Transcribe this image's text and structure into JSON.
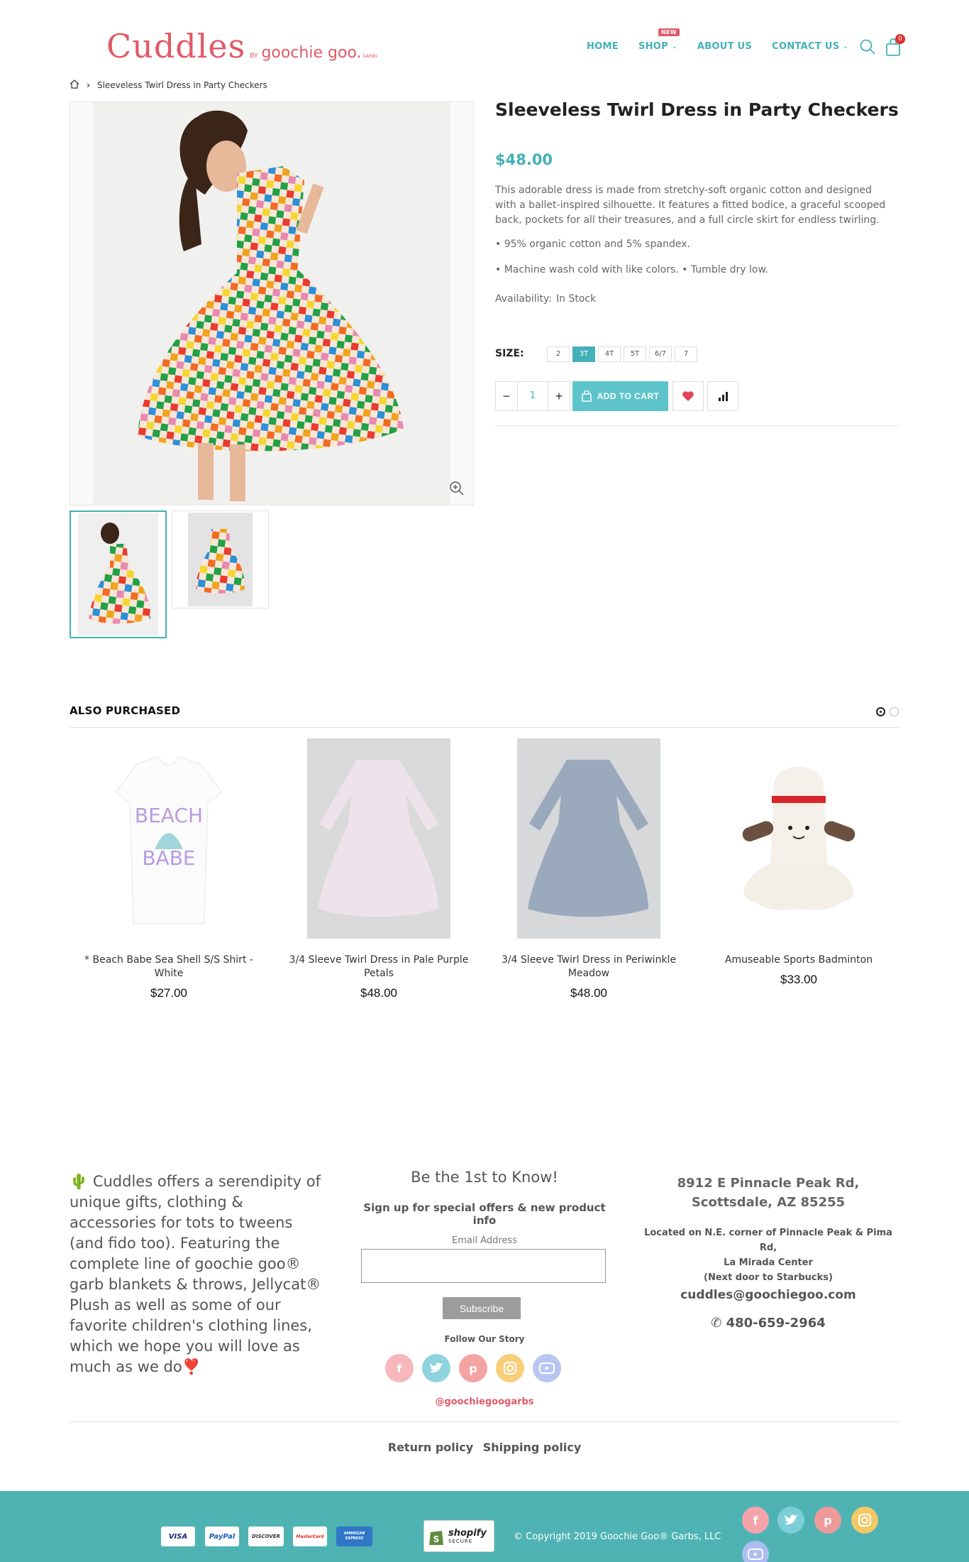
{
  "header": {
    "logo_main": "Cuddles",
    "logo_by": "BY",
    "logo_sub": "goochie goo.",
    "logo_tag": "GARBS",
    "nav": [
      {
        "label": "HOME"
      },
      {
        "label": "SHOP",
        "badge": "NEW"
      },
      {
        "label": "ABOUT US"
      },
      {
        "label": "CONTACT US"
      }
    ],
    "cart_count": "0"
  },
  "breadcrumb": {
    "current": "Sleeveless Twirl Dress in Party Checkers"
  },
  "product": {
    "title": "Sleeveless Twirl Dress in Party Checkers",
    "price": "$48.00",
    "description": "This adorable dress is made from stretchy-soft organic cotton and designed with a ballet-inspired silhouette. It features a fitted bodice, a graceful scooped back, pockets for all their treasures, and a full circle skirt for endless twirling.",
    "bullet_1": "• 95% organic cotton and 5% spandex.",
    "bullet_2": "• Machine wash cold with like colors. • Tumble dry low.",
    "availability_label": "Availability:",
    "availability_value": "In Stock",
    "size_label": "SIZE:",
    "sizes": [
      "2",
      "3T",
      "4T",
      "5T",
      "6/7",
      "7"
    ],
    "selected_size": "3T",
    "quantity": "1",
    "add_to_cart": "ADD TO CART"
  },
  "also_purchased": {
    "title": "ALSO PURCHASED",
    "items": [
      {
        "name": "* Beach Babe Sea Shell S/S Shirt - White",
        "price": "$27.00",
        "shirt_text_1": "BEACH",
        "shirt_text_2": "BABE"
      },
      {
        "name": "3/4 Sleeve Twirl Dress in Pale Purple Petals",
        "price": "$48.00"
      },
      {
        "name": "3/4 Sleeve Twirl Dress in Periwinkle Meadow",
        "price": "$48.00"
      },
      {
        "name": "Amuseable Sports Badminton",
        "price": "$33.00"
      }
    ]
  },
  "footer": {
    "about": "🌵 Cuddles offers a serendipity of unique gifts, clothing & accessories for tots to tweens (and fido too).  Featuring the complete line of goochie goo® garb blankets & throws, Jellycat® Plush as well as some of our favorite children's clothing lines, which we hope you will love as much as we do❣️",
    "signup_heading": "Be the 1st to Know!",
    "signup_sub": "Sign up for special offers & new product info",
    "email_label": "Email Address",
    "subscribe": "Subscribe",
    "follow": "Follow Our Story",
    "handle": "@goochiegoogarbs",
    "address_1": "8912 E Pinnacle Peak Rd,",
    "address_2": "Scottsdale, AZ 85255",
    "location_1": "Located on N.E. corner of Pinnacle Peak & Pima Rd,",
    "location_2": "La Mirada Center",
    "location_3": "(Next door to Starbucks)",
    "email": "cuddles@goochiegoo.com",
    "phone": "480-659-2964",
    "links": [
      "Return policy",
      "Shipping policy"
    ],
    "payments": [
      "VISA",
      "PayPal",
      "DISCOVER",
      "MasterCard",
      "AMERICAN EXPRESS"
    ],
    "shopify_1": "shopify",
    "shopify_2": "SECURE",
    "copyright": "© Copyright 2019 Goochie Goo® Garbs, LLC"
  },
  "colors": {
    "accent": "#44b0b8",
    "brand": "#e05a67",
    "footer_bar": "#4fb3b3"
  }
}
